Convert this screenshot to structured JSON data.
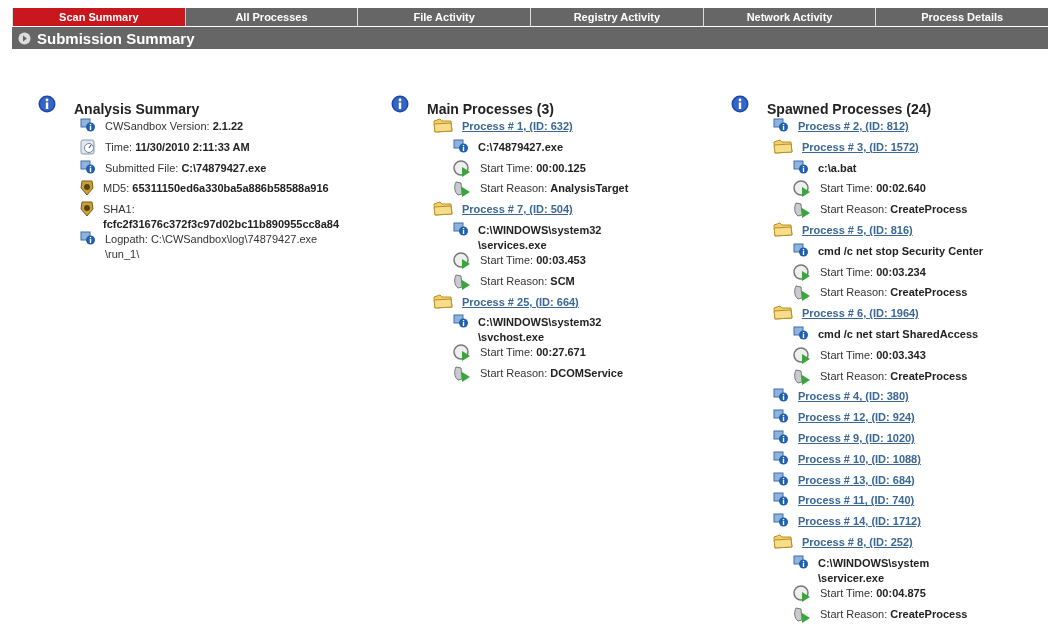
{
  "tabs": [
    {
      "label": "Scan Summary",
      "selected": true
    },
    {
      "label": "All Processes",
      "selected": false
    },
    {
      "label": "File Activity",
      "selected": false
    },
    {
      "label": "Registry Activity",
      "selected": false
    },
    {
      "label": "Network Activity",
      "selected": false
    },
    {
      "label": "Process Details",
      "selected": false
    }
  ],
  "header": {
    "title": "Submission Summary"
  },
  "sections": [
    {
      "title": "Analysis Summary",
      "kind": "summary",
      "items": [
        {
          "kind": "info",
          "label": "CWSandbox Version:",
          "lines": [
            "2.1.22"
          ]
        },
        {
          "kind": "clock",
          "label": "Time:",
          "lines": [
            "11/30/2010 2:11:33 AM"
          ]
        },
        {
          "kind": "info",
          "label": "Submitted File:",
          "lines": [
            "C:\\74879427.exe"
          ]
        },
        {
          "kind": "badge",
          "label": "MD5:",
          "lines": [
            "65311150ed6a330ba5a886b58588a916"
          ]
        },
        {
          "kind": "badge",
          "label": "SHA1:",
          "value_below": true,
          "lines": [
            "fcfc2f31676c372f3c97d02bc11b890955cc8a84"
          ]
        },
        {
          "kind": "info",
          "label": "Logpath:",
          "bold": false,
          "lines": [
            "C:\\CWSandbox\\log\\74879427.exe",
            "\\run_1\\"
          ]
        }
      ]
    },
    {
      "title": "Main Processes (3)",
      "kind": "processes",
      "items": [
        {
          "kind": "folder",
          "link": "Process # 1, (ID: 632)",
          "details": [
            {
              "kind": "info",
              "lines": [
                "C:\\74879427.exe"
              ]
            },
            {
              "kind": "start-time",
              "label": "Start Time:",
              "lines": [
                "00:00.125"
              ]
            },
            {
              "kind": "start-reason",
              "label": "Start Reason:",
              "lines": [
                "AnalysisTarget"
              ]
            }
          ]
        },
        {
          "kind": "folder",
          "link": "Process # 7, (ID: 504)",
          "details": [
            {
              "kind": "info",
              "lines": [
                "C:\\WINDOWS\\system32",
                "\\services.exe"
              ]
            },
            {
              "kind": "start-time",
              "label": "Start Time:",
              "lines": [
                "00:03.453"
              ]
            },
            {
              "kind": "start-reason",
              "label": "Start Reason:",
              "lines": [
                "SCM"
              ]
            }
          ]
        },
        {
          "kind": "folder",
          "link": "Process # 25, (ID: 664)",
          "details": [
            {
              "kind": "info",
              "lines": [
                "C:\\WINDOWS\\system32",
                "\\svchost.exe"
              ]
            },
            {
              "kind": "start-time",
              "label": "Start Time:",
              "lines": [
                "00:27.671"
              ]
            },
            {
              "kind": "start-reason",
              "label": "Start Reason:",
              "lines": [
                "DCOMService"
              ]
            }
          ]
        }
      ]
    },
    {
      "title": "Spawned Processes (24)",
      "kind": "processes",
      "items": [
        {
          "kind": "info",
          "link": "Process # 2, (ID: 812)"
        },
        {
          "kind": "folder",
          "link": "Process # 3, (ID: 1572)",
          "details": [
            {
              "kind": "info",
              "lines": [
                "c:\\a.bat"
              ]
            },
            {
              "kind": "start-time",
              "label": "Start Time:",
              "lines": [
                "00:02.640"
              ]
            },
            {
              "kind": "start-reason",
              "label": "Start Reason:",
              "lines": [
                "CreateProcess"
              ]
            }
          ]
        },
        {
          "kind": "folder",
          "link": "Process # 5, (ID: 816)",
          "details": [
            {
              "kind": "info",
              "lines": [
                "cmd /c net stop Security Center"
              ]
            },
            {
              "kind": "start-time",
              "label": "Start Time:",
              "lines": [
                "00:03.234"
              ]
            },
            {
              "kind": "start-reason",
              "label": "Start Reason:",
              "lines": [
                "CreateProcess"
              ]
            }
          ]
        },
        {
          "kind": "folder",
          "link": "Process # 6, (ID: 1964)",
          "details": [
            {
              "kind": "info",
              "lines": [
                "cmd /c net start SharedAccess"
              ]
            },
            {
              "kind": "start-time",
              "label": "Start Time:",
              "lines": [
                "00:03.343"
              ]
            },
            {
              "kind": "start-reason",
              "label": "Start Reason:",
              "lines": [
                "CreateProcess"
              ]
            }
          ]
        },
        {
          "kind": "info",
          "link": "Process # 4, (ID: 380)"
        },
        {
          "kind": "info",
          "link": "Process # 12, (ID: 924)"
        },
        {
          "kind": "info",
          "link": "Process # 9, (ID: 1020)"
        },
        {
          "kind": "info",
          "link": "Process # 10, (ID: 1088)"
        },
        {
          "kind": "info",
          "link": "Process # 13, (ID: 684)"
        },
        {
          "kind": "info",
          "link": "Process # 11, (ID: 740)"
        },
        {
          "kind": "info",
          "link": "Process # 14, (ID: 1712)"
        },
        {
          "kind": "folder",
          "link": "Process # 8, (ID: 252)",
          "details": [
            {
              "kind": "info",
              "lines": [
                "C:\\WINDOWS\\system",
                "\\servicer.exe"
              ]
            },
            {
              "kind": "start-time",
              "label": "Start Time:",
              "lines": [
                "00:04.875"
              ]
            },
            {
              "kind": "start-reason",
              "label": "Start Reason:",
              "lines": [
                "CreateProcess"
              ]
            }
          ]
        }
      ]
    }
  ]
}
